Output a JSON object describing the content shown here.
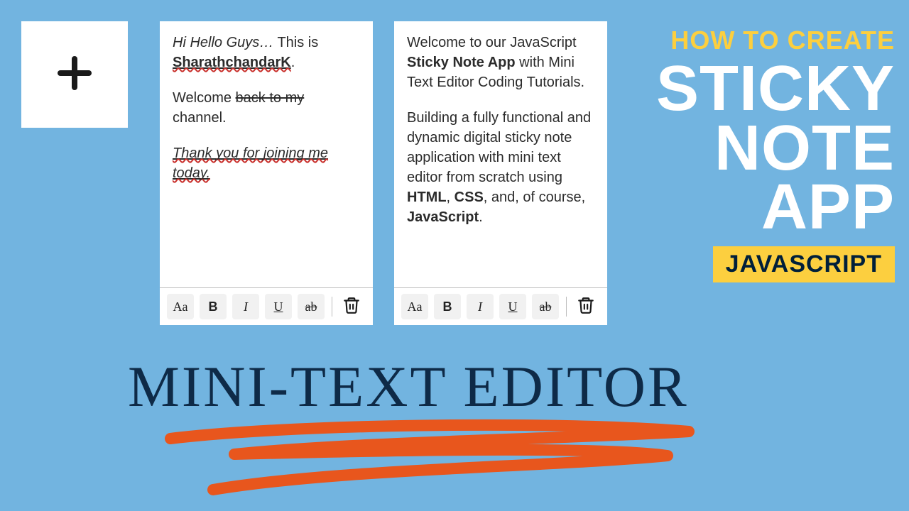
{
  "addButton": {
    "label": "Add Note"
  },
  "notes": [
    {
      "line1_italic": "Hi Hello Guys…",
      "line1_rest": " This is ",
      "author": "SharathchandarK",
      "period": ".",
      "line2_pre": "Welcome ",
      "line2_strike": "back to my",
      "line2_post": " channel.",
      "thanks": "Thank you for joining me today."
    },
    {
      "p1_pre": "Welcome to our JavaScript ",
      "p1_bold": "Sticky Note App",
      "p1_post": " with Mini Text Editor Coding Tutorials.",
      "p2_pre": "Building a fully functional and dynamic digital sticky note application with mini text editor from scratch using ",
      "p2_b1": "HTML",
      "p2_mid1": ", ",
      "p2_b2": "CSS",
      "p2_mid2": ", and, of course, ",
      "p2_b3": "JavaScript",
      "p2_post": "."
    }
  ],
  "toolbar": {
    "aa": "Aa",
    "bold": "B",
    "italic": "I",
    "underline": "U",
    "strike": "ab"
  },
  "heading": {
    "small": "HOW TO CREATE",
    "line1": "STICKY",
    "line2": "NOTE",
    "line3": "APP",
    "badge": "JAVASCRIPT"
  },
  "handwritten": "MINI-TEXT EDITOR"
}
